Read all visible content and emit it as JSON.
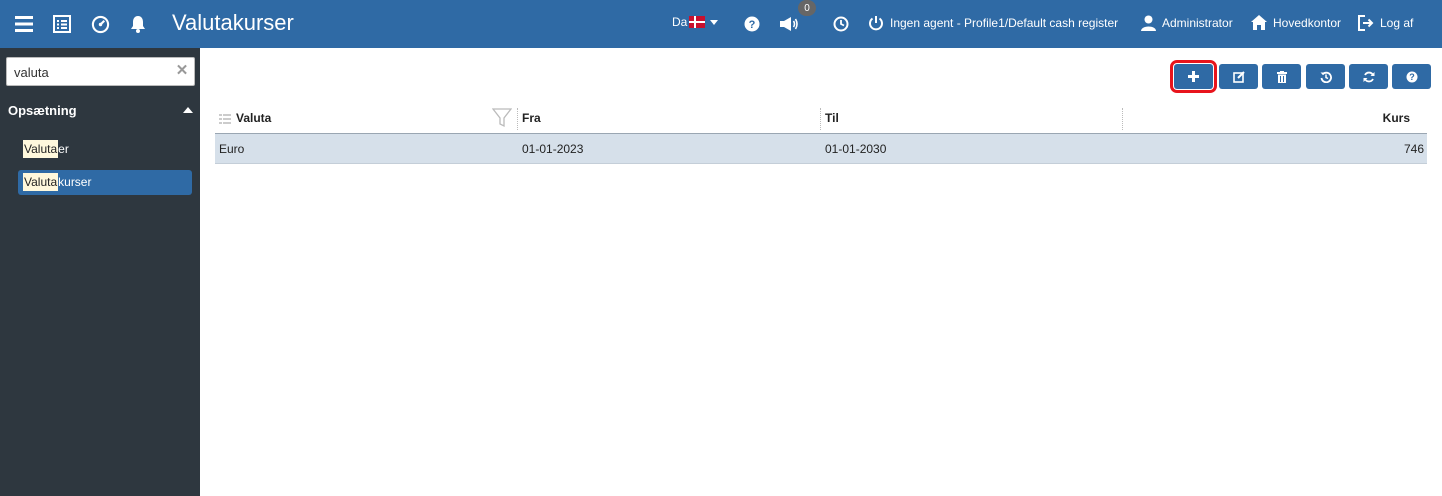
{
  "header": {
    "title": "Valutakurser",
    "language": "Da",
    "notification_count": "0",
    "agent_label": "Ingen agent - Profile1/Default cash register",
    "user_label": "Administrator",
    "office_label": "Hovedkontor",
    "logout_label": "Log af",
    "colors": {
      "bar": "#2f6aa5"
    }
  },
  "sidebar": {
    "search": {
      "value": "valuta",
      "placeholder": ""
    },
    "section": {
      "label": "Opsætning"
    },
    "items": [
      {
        "highlight": "Valuta",
        "rest": "er",
        "active": false
      },
      {
        "highlight": "Valuta",
        "rest": "kurser",
        "active": true
      }
    ]
  },
  "toolbar": {
    "buttons": [
      {
        "name": "add-button",
        "icon": "plus-icon",
        "highlighted": true
      },
      {
        "name": "edit-button",
        "icon": "edit-icon"
      },
      {
        "name": "delete-button",
        "icon": "trash-icon"
      },
      {
        "name": "history-button",
        "icon": "history-icon"
      },
      {
        "name": "refresh-button",
        "icon": "refresh-icon"
      },
      {
        "name": "help-button",
        "icon": "question-icon"
      }
    ],
    "colors": {
      "button": "#2f6aa5",
      "highlight_outline": "#e8141c"
    }
  },
  "grid": {
    "columns": [
      "Valuta",
      "Fra",
      "Til",
      "Kurs"
    ],
    "rows": [
      [
        "Euro",
        "01-01-2023",
        "01-01-2030",
        "746"
      ]
    ],
    "colors": {
      "selected_row": "#d6e0ea"
    }
  }
}
